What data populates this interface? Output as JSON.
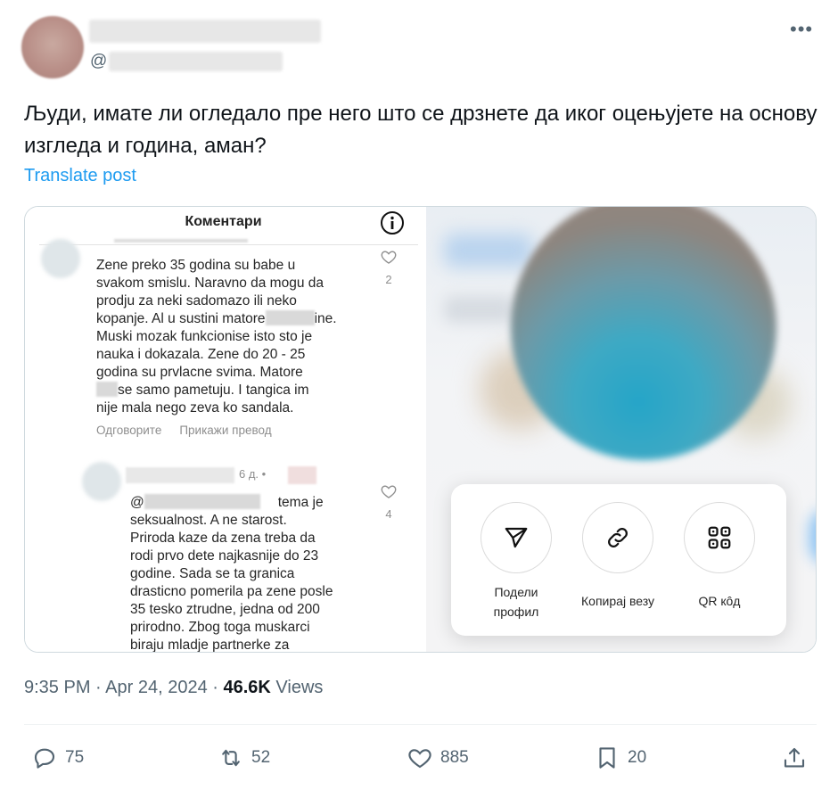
{
  "author": {
    "handle_prefix": "@"
  },
  "tweet": {
    "text": "Људи, имате ли огледало пре него што се дрзнете да иког оцењујете на основу изгледа и година, аман?",
    "translate_label": "Translate post"
  },
  "media": {
    "panel_title": "Коментари",
    "comment1": {
      "line1": "Zene preko 35 godina su babe u\nsvakom smislu. Naravno da mogu da\nprodju za neki sadomazo ili neko\nkopanje. Al u sustini matore",
      "line1_tail": "ine.",
      "line2": "Muski mozak funkcionise isto sto je\nnauka i dokazala. Zene do 20 - 25\ngodina su prvlacne svima. Matore\n",
      "line2_tail": "se samo pametuju. I tangica im\nnije mala nego zeva ko sandala.",
      "likes": "2",
      "reply_label": "Одговорите",
      "translate_label": "Прикажи превод"
    },
    "comment2": {
      "meta": "6 д. •",
      "mention_prefix": "@",
      "first_tail": "tema je",
      "text": "seksualnost. A ne starost.\nPriroda kaze da zena treba da\nrodi prvo dete najkasnije do 23\ngodine. Sada se ta granica\ndrasticno pomerila pa zene posle\n35 tesko ztrudne, jedna od 200\nprirodno. Zbog toga muskarci\nbiraju mladje partnerke za",
      "likes": "4"
    },
    "share_sheet": {
      "share_profile_line1": "Подели",
      "share_profile_line2": "профил",
      "copy_link": "Копирај везу",
      "qr_code": "QR кôд"
    }
  },
  "meta": {
    "time": "9:35 PM",
    "sep1": " · ",
    "date": "Apr 24, 2024",
    "sep2": " · ",
    "views_count": "46.6K",
    "views_label": " Views"
  },
  "actions": {
    "replies": "75",
    "reposts": "52",
    "likes": "885",
    "bookmarks": "20"
  },
  "colors": {
    "accent": "#1d9bf0",
    "text_secondary": "#536471"
  }
}
